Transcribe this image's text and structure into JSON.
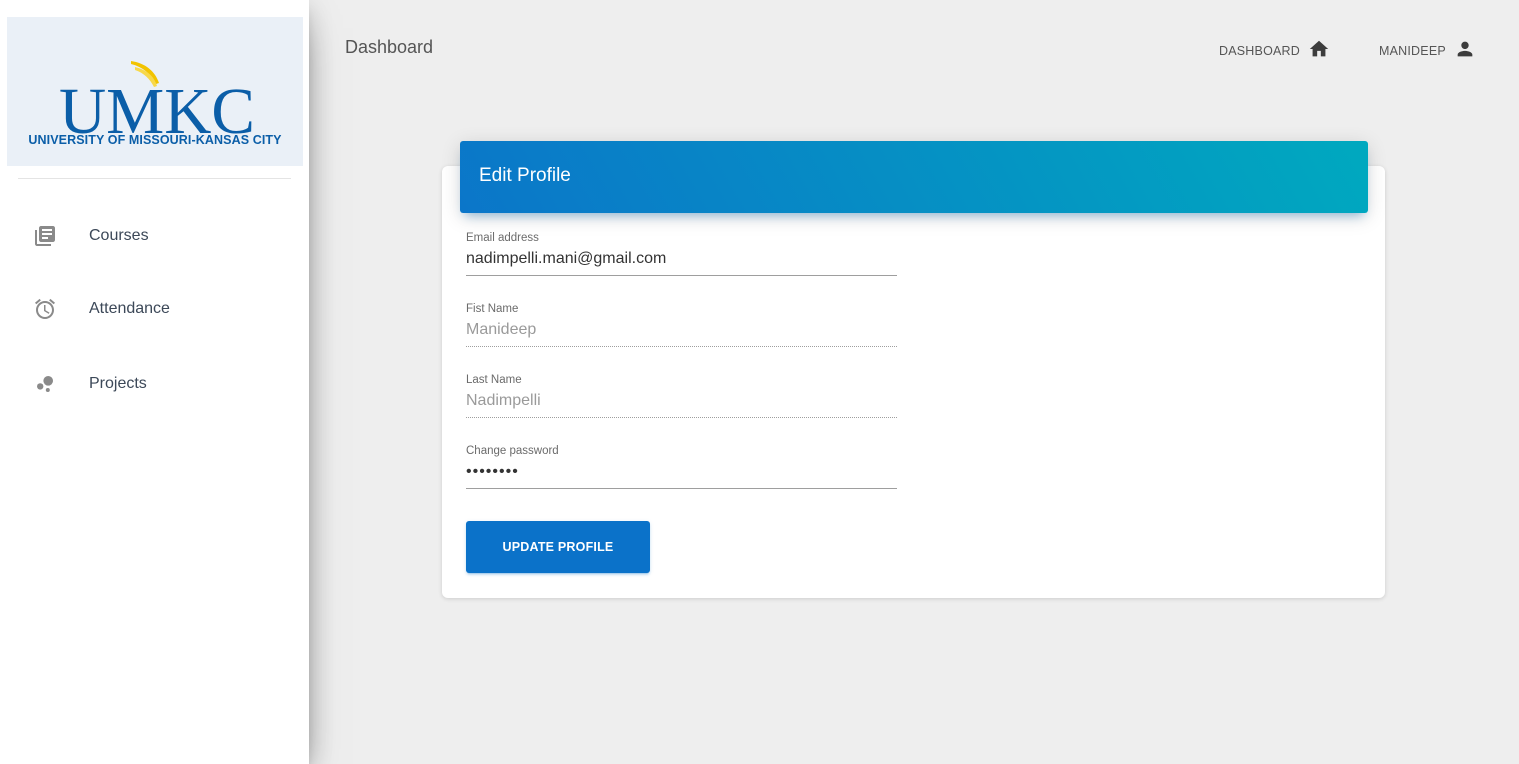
{
  "sidebar": {
    "logo_text": "UMKC",
    "logo_subtitle": "UNIVERSITY OF MISSOURI-KANSAS CITY",
    "items": [
      {
        "label": "Courses",
        "icon": "library-books-icon"
      },
      {
        "label": "Attendance",
        "icon": "alarm-icon"
      },
      {
        "label": "Projects",
        "icon": "bubble-chart-icon"
      }
    ]
  },
  "topbar": {
    "title": "Dashboard",
    "dashboard_link": "DASHBOARD",
    "user_link": "MANIDEEP"
  },
  "card": {
    "title": "Edit Profile",
    "fields": {
      "email": {
        "label": "Email address",
        "value": "nadimpelli.mani@gmail.com"
      },
      "first_name": {
        "label": "Fist Name",
        "value": "Manideep"
      },
      "last_name": {
        "label": "Last Name",
        "value": "Nadimpelli"
      },
      "password": {
        "label": "Change password",
        "value": "••••••••"
      }
    },
    "submit_label": "UPDATE PROFILE"
  },
  "colors": {
    "primary": "#0b72c9",
    "header_gradient_start": "#0b76c9",
    "header_gradient_end": "#00a9bf",
    "logo_blue": "#0b5ea8",
    "logo_gold": "#f2c300"
  }
}
